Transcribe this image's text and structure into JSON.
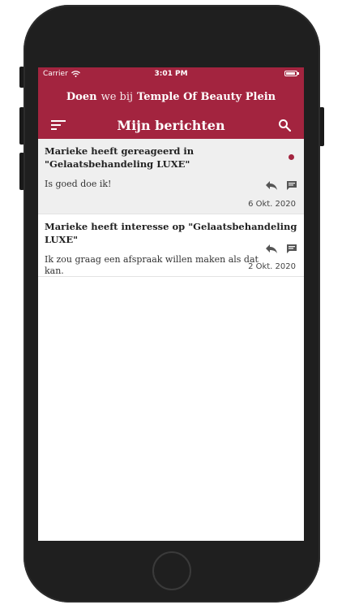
{
  "status_bar": {
    "carrier": "Carrier",
    "time": "3:01 PM",
    "wifi_icon": "wifi-icon",
    "battery_icon": "battery-icon",
    "battery_level": 0.9
  },
  "brand": {
    "doen": "Doen",
    "we_bij": "we bij",
    "place": "Temple Of Beauty Plein"
  },
  "toolbar": {
    "title": "Mijn berichten",
    "menu_icon": "sort-menu-icon",
    "search_icon": "search-icon"
  },
  "messages": [
    {
      "title": "Marieke heeft gereageerd in \"Gelaatsbehandeling LUXE\"",
      "body": "Is goed doe ik!",
      "date": "6 Okt. 2020",
      "unread": true
    },
    {
      "title": "Marieke  heeft interesse op \"Gelaatsbehandeling LUXE\"",
      "body": "Ik zou graag een afspraak willen maken als dat kan.",
      "date": "2 Okt. 2020",
      "unread": false
    }
  ],
  "colors": {
    "brand": "#a3243f",
    "unread_bg": "#efefef",
    "phone_frame": "#1f1f1f"
  }
}
